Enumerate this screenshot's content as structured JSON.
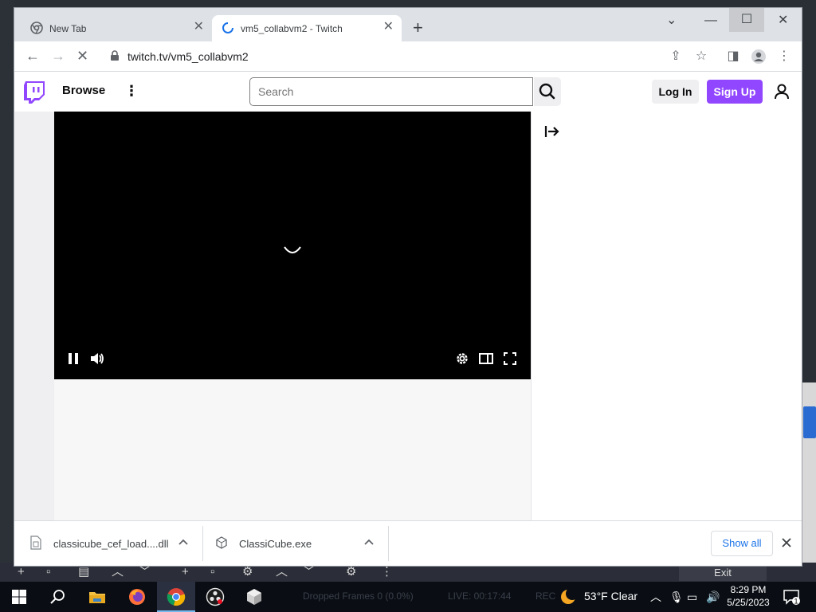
{
  "browser": {
    "tabs": [
      {
        "title": "New Tab"
      },
      {
        "title": "vm5_collabvm2 - Twitch"
      }
    ],
    "url": "twitch.tv/vm5_collabvm2"
  },
  "twitch": {
    "browse_label": "Browse",
    "search_placeholder": "Search",
    "login_label": "Log In",
    "signup_label": "Sign Up",
    "accent_color": "#9147ff"
  },
  "downloads": {
    "items": [
      {
        "name": "classicube_cef_load....dll"
      },
      {
        "name": "ClassiCube.exe"
      }
    ],
    "show_all_label": "Show all"
  },
  "obs": {
    "exit_label": "Exit",
    "dropped_frames": "Dropped Frames 0 (0.0%)",
    "live": "LIVE: 00:17:44",
    "rec": "REC"
  },
  "taskbar": {
    "temperature": "53°F",
    "weather": "Clear",
    "time": "8:29 PM",
    "date": "5/25/2023",
    "notification_count": "1"
  }
}
